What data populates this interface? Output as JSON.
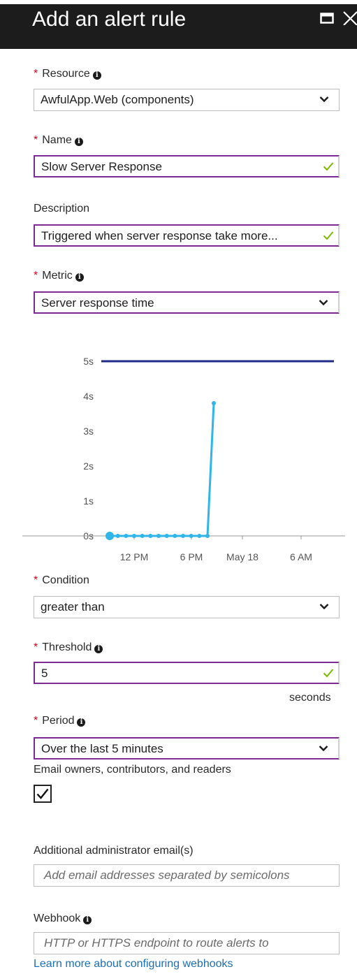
{
  "header": {
    "title": "Add an alert rule"
  },
  "resource": {
    "label": "Resource",
    "value": "AwfulApp.Web (components)"
  },
  "name": {
    "label": "Name",
    "value": "Slow Server Response"
  },
  "description": {
    "label": "Description",
    "value": "Triggered when server response take more..."
  },
  "metric": {
    "label": "Metric",
    "value": "Server response time"
  },
  "chart_data": {
    "type": "line",
    "y_ticks": [
      "5s",
      "4s",
      "3s",
      "2s",
      "1s",
      "0s"
    ],
    "x_ticks": [
      "12 PM",
      "6 PM",
      "May 18",
      "6 AM"
    ],
    "ylim": [
      0,
      5.5
    ],
    "threshold": 5,
    "series": [
      {
        "values": [
          0,
          0,
          0,
          0,
          0,
          0,
          0,
          0,
          0,
          0,
          0,
          0,
          0,
          3.8
        ]
      }
    ],
    "colors": {
      "series": "#2fb5e8",
      "threshold": "#1f2a8a",
      "axis": "#9a9a9a"
    }
  },
  "condition": {
    "label": "Condition",
    "value": "greater than"
  },
  "threshold": {
    "label": "Threshold",
    "value": "5",
    "unit": "seconds"
  },
  "period": {
    "label": "Period",
    "value": "Over the last 5 minutes"
  },
  "email": {
    "label": "Email owners, contributors, and readers",
    "checked": true
  },
  "additional": {
    "label": "Additional administrator email(s)",
    "placeholder": "Add email addresses separated by semicolons"
  },
  "webhook": {
    "label": "Webhook",
    "placeholder": "HTTP or HTTPS endpoint to route alerts to",
    "link": "Learn more about configuring webhooks"
  },
  "colors": {
    "accent": "#7b2b93",
    "required": "#d0021b",
    "valid": "#7fba00",
    "link": "#1c6fb5"
  }
}
